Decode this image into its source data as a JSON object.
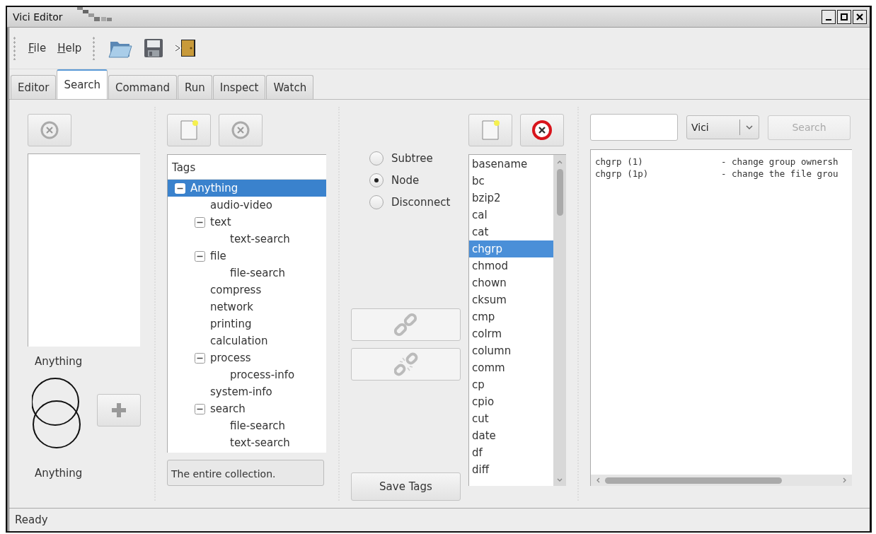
{
  "window": {
    "title": "Vici Editor"
  },
  "menu": [
    {
      "label": "File"
    },
    {
      "label": "Help"
    }
  ],
  "tabs": [
    {
      "label": "Editor",
      "selected": false
    },
    {
      "label": "Search",
      "selected": true
    },
    {
      "label": "Command",
      "selected": false
    },
    {
      "label": "Run",
      "selected": false
    },
    {
      "label": "Inspect",
      "selected": false
    },
    {
      "label": "Watch",
      "selected": false
    }
  ],
  "set_panel": {
    "label_top": "Anything",
    "label_bottom": "Anything"
  },
  "tree": {
    "header": "Tags",
    "description": "The entire collection.",
    "items": [
      {
        "label": "Anything",
        "selected": true,
        "expanded": true,
        "children": [
          {
            "label": "audio-video",
            "selected": false
          },
          {
            "label": "text",
            "selected": false,
            "expanded": true,
            "children": [
              {
                "label": "text-search",
                "selected": false
              }
            ]
          },
          {
            "label": "file",
            "selected": false,
            "expanded": true,
            "children": [
              {
                "label": "file-search",
                "selected": false
              }
            ]
          },
          {
            "label": "compress",
            "selected": false
          },
          {
            "label": "network",
            "selected": false
          },
          {
            "label": "printing",
            "selected": false
          },
          {
            "label": "calculation",
            "selected": false
          },
          {
            "label": "process",
            "selected": false,
            "expanded": true,
            "children": [
              {
                "label": "process-info",
                "selected": false
              }
            ]
          },
          {
            "label": "system-info",
            "selected": false
          },
          {
            "label": "search",
            "selected": false,
            "expanded": true,
            "children": [
              {
                "label": "file-search",
                "selected": false
              },
              {
                "label": "text-search",
                "selected": false
              }
            ]
          }
        ]
      }
    ]
  },
  "mode_options": [
    {
      "label": "Subtree",
      "selected": false
    },
    {
      "label": "Node",
      "selected": true
    },
    {
      "label": "Disconnect",
      "selected": false
    }
  ],
  "save_button": "Save Tags",
  "commands": [
    {
      "name": "basename",
      "selected": false
    },
    {
      "name": "bc",
      "selected": false
    },
    {
      "name": "bzip2",
      "selected": false
    },
    {
      "name": "cal",
      "selected": false
    },
    {
      "name": "cat",
      "selected": false
    },
    {
      "name": "chgrp",
      "selected": true
    },
    {
      "name": "chmod",
      "selected": false
    },
    {
      "name": "chown",
      "selected": false
    },
    {
      "name": "cksum",
      "selected": false
    },
    {
      "name": "cmp",
      "selected": false
    },
    {
      "name": "colrm",
      "selected": false
    },
    {
      "name": "column",
      "selected": false
    },
    {
      "name": "comm",
      "selected": false
    },
    {
      "name": "cp",
      "selected": false
    },
    {
      "name": "cpio",
      "selected": false
    },
    {
      "name": "cut",
      "selected": false
    },
    {
      "name": "date",
      "selected": false
    },
    {
      "name": "df",
      "selected": false
    },
    {
      "name": "diff",
      "selected": false
    }
  ],
  "search": {
    "combo": "Vici",
    "button": {
      "label": "Search",
      "disabled": true
    },
    "results": [
      {
        "name": "chgrp (1)",
        "description": "- change group ownersh"
      },
      {
        "name": "chgrp (1p)",
        "description": "- change the file grou"
      }
    ]
  },
  "status_bar": "Ready"
}
